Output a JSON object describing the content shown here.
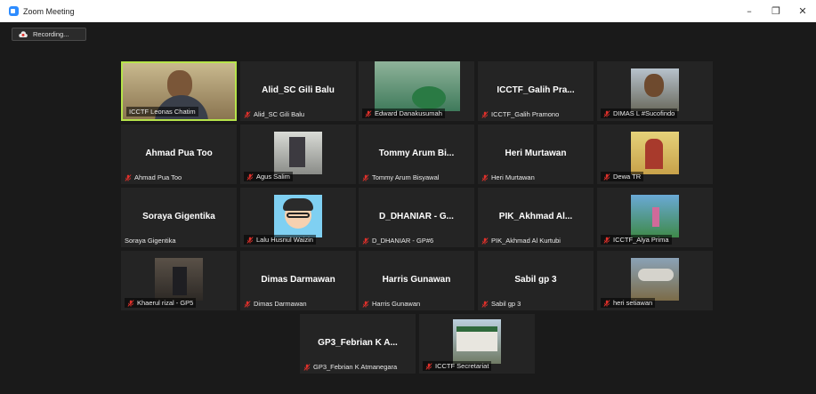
{
  "window": {
    "title": "Zoom Meeting",
    "controls": [
      "–",
      "❐",
      "✕"
    ]
  },
  "recording": {
    "label": "Recording..."
  },
  "accent": {
    "active_speaker": "#b6e34a",
    "muted": "#e0312b",
    "window_icon": "#2d8cff"
  },
  "participants": [
    {
      "label": "ICCTF Leonas Chatim",
      "name": "",
      "muted": false,
      "video": true,
      "active": true
    },
    {
      "label": "Alid_SC Gili Balu",
      "name": "Alid_SC Gili Balu",
      "muted": true,
      "video": false
    },
    {
      "label": "Edward Danakusumah",
      "name": "",
      "muted": true,
      "video": true
    },
    {
      "label": "ICCTF_Galih Pramono",
      "name": "ICCTF_Galih  Pra...",
      "muted": true,
      "video": false
    },
    {
      "label": "DIMAS L #Sucofindo",
      "name": "",
      "muted": true,
      "video": true
    },
    {
      "label": "Ahmad Pua Too",
      "name": "Ahmad Pua Too",
      "muted": true,
      "video": false
    },
    {
      "label": "Agus Salim",
      "name": "",
      "muted": true,
      "video": true
    },
    {
      "label": "Tommy Arum Bisyawal",
      "name": "Tommy Arum Bi...",
      "muted": true,
      "video": false
    },
    {
      "label": "Heri Murtawan",
      "name": "Heri Murtawan",
      "muted": true,
      "video": false
    },
    {
      "label": "Dewa TR",
      "name": "",
      "muted": true,
      "video": true
    },
    {
      "label": "Soraya Gigentika",
      "name": "Soraya Gigentika",
      "muted": false,
      "video": false
    },
    {
      "label": "Lalu Husnul Waizin",
      "name": "",
      "muted": true,
      "video": true
    },
    {
      "label": "D_DHANIAR - GP#6",
      "name": "D_DHANIAR - G...",
      "muted": true,
      "video": false
    },
    {
      "label": "PIK_Akhmad Al Kurtubi",
      "name": "PIK_Akhmad Al...",
      "muted": true,
      "video": false
    },
    {
      "label": "ICCTF_Alya Prima",
      "name": "",
      "muted": true,
      "video": true
    },
    {
      "label": "Khaerul rizal - GP5",
      "name": "",
      "muted": true,
      "video": true
    },
    {
      "label": "Dimas Darmawan",
      "name": "Dimas Darmawan",
      "muted": true,
      "video": false
    },
    {
      "label": "Harris Gunawan",
      "name": "Harris Gunawan",
      "muted": true,
      "video": false
    },
    {
      "label": "Sabil gp 3",
      "name": "Sabil gp 3",
      "muted": true,
      "video": false
    },
    {
      "label": "heri setiawan",
      "name": "",
      "muted": true,
      "video": true
    },
    {
      "label": "GP3_Febrian K Atmanegara",
      "name": "GP3_Febrian K A...",
      "muted": true,
      "video": false
    },
    {
      "label": "ICCTF Secretariat",
      "name": "",
      "muted": true,
      "video": true
    }
  ]
}
